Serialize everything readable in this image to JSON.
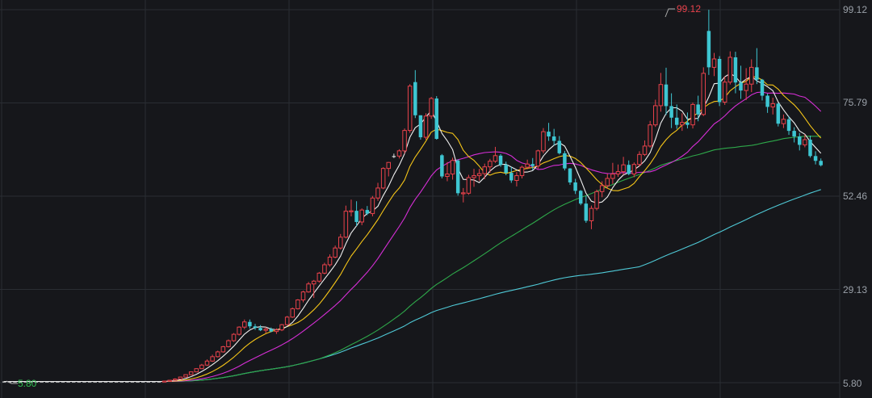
{
  "chart_data": {
    "type": "candlestick",
    "title": "",
    "y_ticks": [
      "99.12",
      "75.79",
      "52.46",
      "29.13",
      "5.80"
    ],
    "ylim": [
      5.8,
      99.12
    ],
    "grid": true,
    "annotations": {
      "high": "99.12",
      "low": "5.80"
    },
    "colors": {
      "background": "#16171b",
      "grid": "#2a2d33",
      "up": "#e8424b",
      "down": "#3ec6d2",
      "doji": "#dddddd",
      "ma5": "#f0f0f0",
      "ma10": "#f5c518",
      "ma20": "#d62ed6",
      "ma60": "#2ea84a",
      "ma120": "#4fc9d6"
    },
    "candles": [
      [
        6.1,
        6.2,
        6.0,
        6.1
      ],
      [
        6.1,
        6.2,
        6.0,
        6.1
      ],
      [
        6.1,
        6.2,
        6.0,
        6.1
      ],
      [
        6.1,
        6.2,
        6.0,
        6.1
      ],
      [
        6.1,
        6.2,
        6.0,
        6.1
      ],
      [
        6.1,
        6.2,
        6.0,
        6.1
      ],
      [
        6.1,
        6.2,
        6.0,
        6.1
      ],
      [
        6.1,
        6.2,
        6.0,
        6.1
      ],
      [
        6.1,
        6.2,
        6.0,
        6.1
      ],
      [
        6.1,
        6.2,
        6.0,
        6.1
      ],
      [
        6.1,
        6.2,
        6.0,
        6.1
      ],
      [
        6.1,
        6.2,
        6.0,
        6.1
      ],
      [
        6.1,
        6.2,
        6.0,
        6.1
      ],
      [
        6.1,
        6.2,
        6.0,
        6.1
      ],
      [
        6.1,
        6.2,
        6.0,
        6.1
      ],
      [
        6.1,
        6.2,
        6.0,
        6.1
      ],
      [
        6.1,
        6.2,
        6.0,
        6.1
      ],
      [
        6.1,
        6.2,
        6.0,
        6.1
      ],
      [
        6.1,
        6.2,
        6.0,
        6.1
      ],
      [
        6.1,
        6.2,
        6.0,
        6.1
      ],
      [
        6.1,
        6.2,
        6.0,
        6.1
      ],
      [
        6.1,
        6.2,
        6.0,
        6.1
      ],
      [
        6.1,
        6.2,
        6.0,
        6.1
      ],
      [
        6.1,
        6.2,
        6.0,
        6.1
      ],
      [
        6.1,
        6.2,
        6.0,
        6.1
      ],
      [
        6.1,
        6.2,
        6.0,
        6.1
      ],
      [
        6.1,
        6.2,
        6.0,
        6.1
      ],
      [
        6.1,
        6.2,
        6.0,
        6.1
      ],
      [
        6.1,
        6.2,
        6.0,
        6.1
      ],
      [
        6.1,
        6.2,
        6.0,
        6.1
      ],
      [
        6.1,
        6.3,
        6.0,
        6.2
      ],
      [
        6.2,
        6.5,
        6.1,
        6.4
      ],
      [
        6.4,
        6.9,
        6.3,
        6.7
      ],
      [
        6.7,
        7.3,
        6.6,
        7.2
      ],
      [
        7.2,
        7.9,
        7.1,
        7.8
      ],
      [
        7.8,
        8.6,
        7.7,
        8.5
      ],
      [
        8.5,
        9.4,
        8.4,
        9.3
      ],
      [
        9.3,
        10.5,
        9.2,
        10.2
      ],
      [
        10.2,
        11.6,
        10.0,
        11.2
      ],
      [
        11.2,
        12.8,
        11.0,
        12.3
      ],
      [
        12.3,
        13.8,
        12.1,
        13.5
      ],
      [
        13.5,
        15.0,
        13.3,
        14.8
      ],
      [
        14.8,
        16.6,
        14.6,
        16.3
      ],
      [
        16.3,
        18.2,
        16.0,
        17.9
      ],
      [
        17.9,
        19.9,
        17.6,
        19.7
      ],
      [
        19.7,
        21.6,
        19.2,
        21.0
      ],
      [
        21.0,
        21.6,
        19.3,
        19.9
      ],
      [
        19.9,
        20.5,
        19.0,
        19.5
      ],
      [
        19.5,
        20.2,
        18.7,
        18.9
      ],
      [
        18.9,
        19.7,
        18.2,
        19.2
      ],
      [
        19.2,
        19.6,
        18.4,
        18.6
      ],
      [
        18.6,
        19.4,
        18.0,
        19.0
      ],
      [
        19.0,
        20.5,
        18.7,
        20.3
      ],
      [
        20.3,
        22.5,
        20.1,
        22.2
      ],
      [
        22.2,
        24.6,
        22.0,
        24.3
      ],
      [
        24.3,
        26.7,
        24.1,
        26.5
      ],
      [
        26.5,
        28.8,
        25.9,
        28.5
      ],
      [
        28.5,
        31.0,
        28.3,
        30.5
      ],
      [
        30.5,
        31.5,
        27.0,
        31.2
      ],
      [
        31.2,
        33.5,
        30.8,
        33.2
      ],
      [
        33.2,
        35.8,
        32.9,
        35.3
      ],
      [
        35.3,
        37.9,
        34.8,
        37.2
      ],
      [
        37.2,
        40.1,
        36.9,
        39.5
      ],
      [
        39.5,
        43.0,
        39.1,
        42.2
      ],
      [
        42.2,
        50.1,
        41.9,
        48.7
      ],
      [
        48.7,
        51.6,
        47.4,
        48.8
      ],
      [
        48.8,
        51.2,
        45.0,
        46.0
      ],
      [
        46.0,
        49.4,
        45.2,
        49.0
      ],
      [
        49.0,
        50.0,
        47.7,
        48.1
      ],
      [
        48.1,
        52.5,
        47.4,
        52.0
      ],
      [
        52.0,
        55.8,
        51.3,
        54.5
      ],
      [
        54.5,
        59.7,
        54.2,
        59.4
      ],
      [
        59.4,
        61.0,
        57.4,
        60.9
      ],
      [
        62.5,
        63.1,
        62.0,
        62.5
      ],
      [
        62.5,
        64.2,
        61.9,
        63.8
      ],
      [
        63.8,
        69.4,
        63.1,
        68.9
      ],
      [
        68.9,
        80.5,
        68.3,
        80.0
      ],
      [
        81.0,
        84.0,
        72.0,
        72.7
      ],
      [
        72.7,
        72.7,
        66.6,
        67.2
      ],
      [
        67.2,
        73.2,
        66.6,
        72.5
      ],
      [
        72.5,
        77.3,
        71.8,
        76.9
      ],
      [
        76.9,
        77.5,
        66.6,
        66.8
      ],
      [
        62.7,
        63.0,
        56.9,
        57.4
      ],
      [
        57.4,
        61.0,
        56.2,
        58.0
      ],
      [
        58.0,
        62.1,
        56.6,
        61.4
      ],
      [
        61.4,
        61.7,
        52.6,
        53.2
      ],
      [
        53.2,
        54.5,
        50.9,
        53.3
      ],
      [
        53.2,
        57.8,
        52.8,
        57.1
      ],
      [
        57.1,
        59.3,
        54.8,
        57.6
      ],
      [
        57.6,
        59.3,
        56.3,
        58.1
      ],
      [
        58.1,
        60.6,
        56.7,
        59.8
      ],
      [
        59.8,
        61.8,
        58.3,
        61.2
      ],
      [
        61.2,
        64.8,
        60.8,
        62.6
      ],
      [
        62.6,
        63.0,
        59.8,
        60.3
      ],
      [
        60.3,
        61.1,
        57.7,
        58.3
      ],
      [
        58.3,
        59.8,
        55.8,
        56.4
      ],
      [
        56.4,
        58.5,
        54.9,
        57.6
      ],
      [
        57.6,
        60.1,
        56.9,
        59.7
      ],
      [
        59.7,
        61.6,
        59.2,
        60.5
      ],
      [
        60.5,
        62.0,
        59.0,
        60.0
      ],
      [
        60.0,
        64.1,
        59.3,
        63.8
      ],
      [
        63.8,
        69.5,
        63.2,
        68.6
      ],
      [
        68.6,
        70.8,
        66.3,
        67.4
      ],
      [
        67.4,
        69.3,
        65.1,
        66.3
      ],
      [
        66.3,
        67.5,
        62.9,
        63.2
      ],
      [
        63.2,
        63.8,
        58.9,
        59.4
      ],
      [
        59.4,
        59.5,
        55.3,
        55.9
      ],
      [
        55.9,
        56.8,
        53.0,
        53.8
      ],
      [
        53.8,
        54.0,
        50.2,
        50.6
      ],
      [
        50.6,
        52.6,
        45.8,
        46.3
      ],
      [
        46.3,
        50.1,
        44.2,
        49.4
      ],
      [
        49.4,
        54.1,
        48.9,
        53.6
      ],
      [
        53.6,
        56.2,
        52.2,
        55.1
      ],
      [
        55.1,
        58.1,
        54.3,
        56.9
      ],
      [
        56.9,
        60.8,
        55.5,
        58.0
      ],
      [
        58.0,
        60.4,
        57.3,
        58.6
      ],
      [
        58.6,
        62.3,
        57.8,
        60.3
      ],
      [
        60.3,
        61.4,
        57.7,
        58.0
      ],
      [
        58.0,
        60.9,
        57.2,
        60.4
      ],
      [
        60.4,
        63.7,
        59.8,
        62.9
      ],
      [
        62.9,
        66.4,
        62.5,
        65.0
      ],
      [
        65.0,
        71.3,
        64.6,
        70.3
      ],
      [
        70.3,
        76.6,
        69.8,
        75.1
      ],
      [
        75.1,
        83.3,
        73.6,
        80.4
      ],
      [
        80.4,
        84.6,
        72.8,
        75.0
      ],
      [
        75.0,
        78.2,
        69.5,
        72.1
      ],
      [
        72.1,
        75.4,
        69.3,
        70.3
      ],
      [
        70.3,
        73.2,
        68.8,
        70.9
      ],
      [
        70.9,
        73.4,
        69.4,
        70.3
      ],
      [
        70.3,
        75.9,
        69.4,
        75.4
      ],
      [
        75.4,
        77.6,
        71.2,
        72.9
      ],
      [
        72.9,
        84.7,
        72.5,
        83.2
      ],
      [
        93.8,
        99.1,
        82.8,
        84.7
      ],
      [
        84.7,
        88.3,
        82.5,
        86.8
      ],
      [
        86.8,
        87.5,
        75.0,
        76.0
      ],
      [
        76.0,
        82.4,
        75.3,
        81.0
      ],
      [
        81.0,
        88.7,
        80.4,
        87.2
      ],
      [
        87.2,
        88.6,
        78.2,
        80.9
      ],
      [
        80.9,
        85.1,
        76.8,
        78.9
      ],
      [
        78.9,
        84.5,
        76.5,
        80.5
      ],
      [
        80.5,
        86.7,
        78.5,
        84.7
      ],
      [
        84.7,
        89.5,
        80.5,
        81.6
      ],
      [
        81.6,
        81.8,
        76.4,
        77.6
      ],
      [
        77.6,
        78.1,
        73.3,
        74.8
      ],
      [
        74.8,
        77.1,
        72.9,
        75.6
      ],
      [
        75.6,
        75.8,
        69.9,
        70.6
      ],
      [
        70.6,
        72.9,
        69.5,
        71.7
      ],
      [
        71.7,
        72.5,
        67.8,
        68.8
      ],
      [
        68.8,
        69.7,
        65.9,
        67.4
      ],
      [
        67.4,
        68.3,
        63.9,
        65.3
      ],
      [
        65.3,
        67.9,
        64.7,
        66.6
      ],
      [
        66.6,
        67.6,
        62.1,
        62.5
      ],
      [
        62.5,
        63.7,
        60.4,
        61.3
      ],
      [
        61.3,
        61.9,
        59.9,
        60.2
      ]
    ]
  }
}
